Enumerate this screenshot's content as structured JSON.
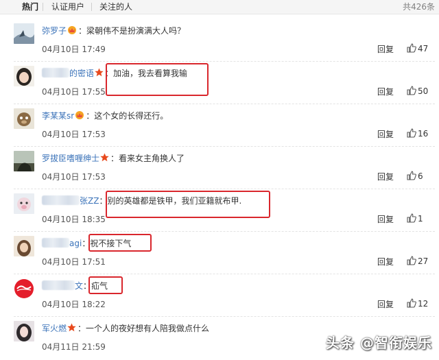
{
  "tabs": {
    "hot": "热门",
    "verified": "认证用户",
    "following": "关注的人",
    "total": "共426条"
  },
  "reply_label": "回复",
  "comments": [
    {
      "user": "弥罗子",
      "text": "梁朝伟不是扮演满大人吗？",
      "time": "04月10日 17:49",
      "likes": "47",
      "badge": "crown"
    },
    {
      "user": "的密语",
      "text": "加油，我去看算我输",
      "time": "04月10日 17:55",
      "likes": "50",
      "badge": "star"
    },
    {
      "user": "李某某sr",
      "text": "这个女的长得还行。",
      "time": "04月10日 17:53",
      "likes": "16",
      "badge": "crown"
    },
    {
      "user": "罗拔臣嗜喱绅士",
      "text": "看来女主角换人了",
      "time": "04月10日 17:53",
      "likes": "6",
      "badge": "star"
    },
    {
      "user": "张ZZ",
      "text": "别的英雄都是铁甲，我们亚籍就布甲.",
      "time": "04月10日 18:35",
      "likes": "1",
      "badge": ""
    },
    {
      "user": "agi",
      "text": "祝不接下气",
      "time": "04月10日 17:51",
      "likes": "27",
      "badge": ""
    },
    {
      "user": "文",
      "text": "疝气",
      "time": "04月10日 18:22",
      "likes": "12",
      "badge": ""
    },
    {
      "user": "军火燃",
      "text": "一个人的夜好想有人陪我做点什么",
      "time": "04月11日 21:59",
      "likes": "",
      "badge": "star"
    }
  ],
  "watermark": {
    "prefix": "头条",
    "name": "智衔娱乐",
    "mark": "@"
  },
  "colors": {
    "username": "#3b73b9",
    "highlight_box": "#d9262c",
    "badge_star": "#e8491d",
    "badge_crown": "#f5a623"
  }
}
